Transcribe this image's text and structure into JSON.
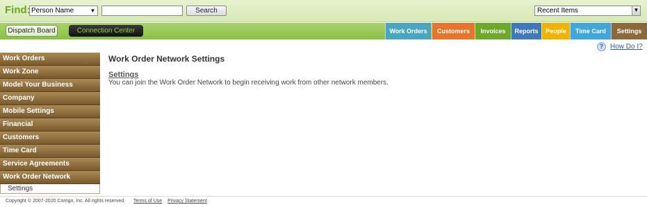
{
  "findbar": {
    "label": "Find:",
    "type_select": "Person Name",
    "search_value": "",
    "search_button": "Search",
    "recent_select": "Recent Items"
  },
  "navbar": {
    "dispatch_board": "Dispatch Board",
    "connection_center": "Connection Center",
    "tabs": [
      {
        "label": "Work Orders",
        "color": "#4aa6c0"
      },
      {
        "label": "Customers",
        "color": "#e6742a"
      },
      {
        "label": "Invoices",
        "color": "#6ca82a"
      },
      {
        "label": "Reports",
        "color": "#3f79b8"
      },
      {
        "label": "People",
        "color": "#f0b400"
      },
      {
        "label": "Time Card",
        "color": "#3fa8d8"
      },
      {
        "label": "Settings",
        "color": "#8a6a3a"
      }
    ]
  },
  "sidebar": {
    "items": [
      "Work Orders",
      "Work Zone",
      "Model Your Business",
      "Company",
      "Mobile Settings",
      "Financial",
      "Customers",
      "Time Card",
      "Service Agreements",
      "Work Order Network"
    ],
    "sub_items": [
      "Settings"
    ]
  },
  "help": {
    "icon_text": "?",
    "link": "How Do I?"
  },
  "main": {
    "title": "Work Order Network Settings",
    "section_heading": "Settings",
    "section_text": "You can join the Work Order Network to begin receiving work from other network members."
  },
  "footer": {
    "copyright": "Copyright © 2007-2020 Corrigo, Inc. All rights reserved.",
    "terms": "Terms of Use",
    "privacy": "Privacy Statement"
  }
}
